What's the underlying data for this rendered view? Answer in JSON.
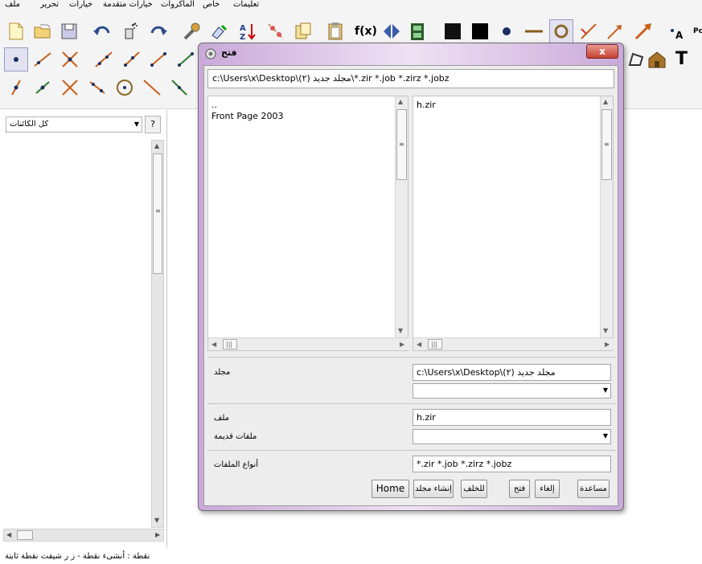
{
  "menu": [
    "ملف",
    "تحرير",
    "خيارات",
    "خيارات متقدمة",
    "الماكروات",
    "خاص",
    "تعليمات"
  ],
  "toolbar": {
    "fx_label": "f(x)",
    "text_label": "T",
    "pc_label": "Pc"
  },
  "left_panel": {
    "objects_select": "كل الكائنات",
    "help_label": "?"
  },
  "status_text": "نقطة : أنشىء نقطة - ز ر شيفت نقطة ثابتة",
  "dialog": {
    "title": "فتح",
    "close_label": "x",
    "path": "c:\\Users\\x\\Desktop\\مجلد جديد (٢)\\*.zir *.job *.zirz *.jobz",
    "dirs": [
      "..",
      "Front Page 2003"
    ],
    "files": [
      "h.zir"
    ],
    "folder_label": "مجلد",
    "folder_value": "c:\\Users\\x\\Desktop\\مجلد جديد (٢)",
    "file_label": "ملف",
    "file_value": "h.zir",
    "old_files_label": "ملفات قديمة",
    "types_label": "أنواع الملفات",
    "types_value": "*.zir *.job *.zirz *.jobz",
    "buttons": {
      "home": "Home",
      "new_folder": "إنشاء مجلد",
      "back": "للخلف",
      "open": "فتح",
      "cancel": "إلغاء",
      "help": "مساعدة"
    }
  }
}
